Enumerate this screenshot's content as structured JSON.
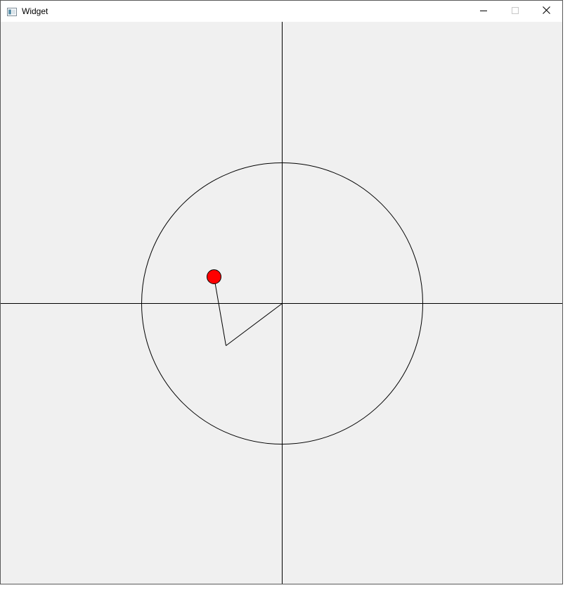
{
  "window": {
    "title": "Widget",
    "app_icon": "qt-window-icon",
    "controls": {
      "minimize": "minimize-icon",
      "maximize": "maximize-icon",
      "close": "close-icon"
    }
  },
  "canvas": {
    "background": "#f0f0f0",
    "line_color": "#000000",
    "joint_color": "#ff0000",
    "elements": [
      "x-axis",
      "y-axis",
      "circle",
      "arm-link-1",
      "arm-link-2",
      "end-effector"
    ]
  }
}
